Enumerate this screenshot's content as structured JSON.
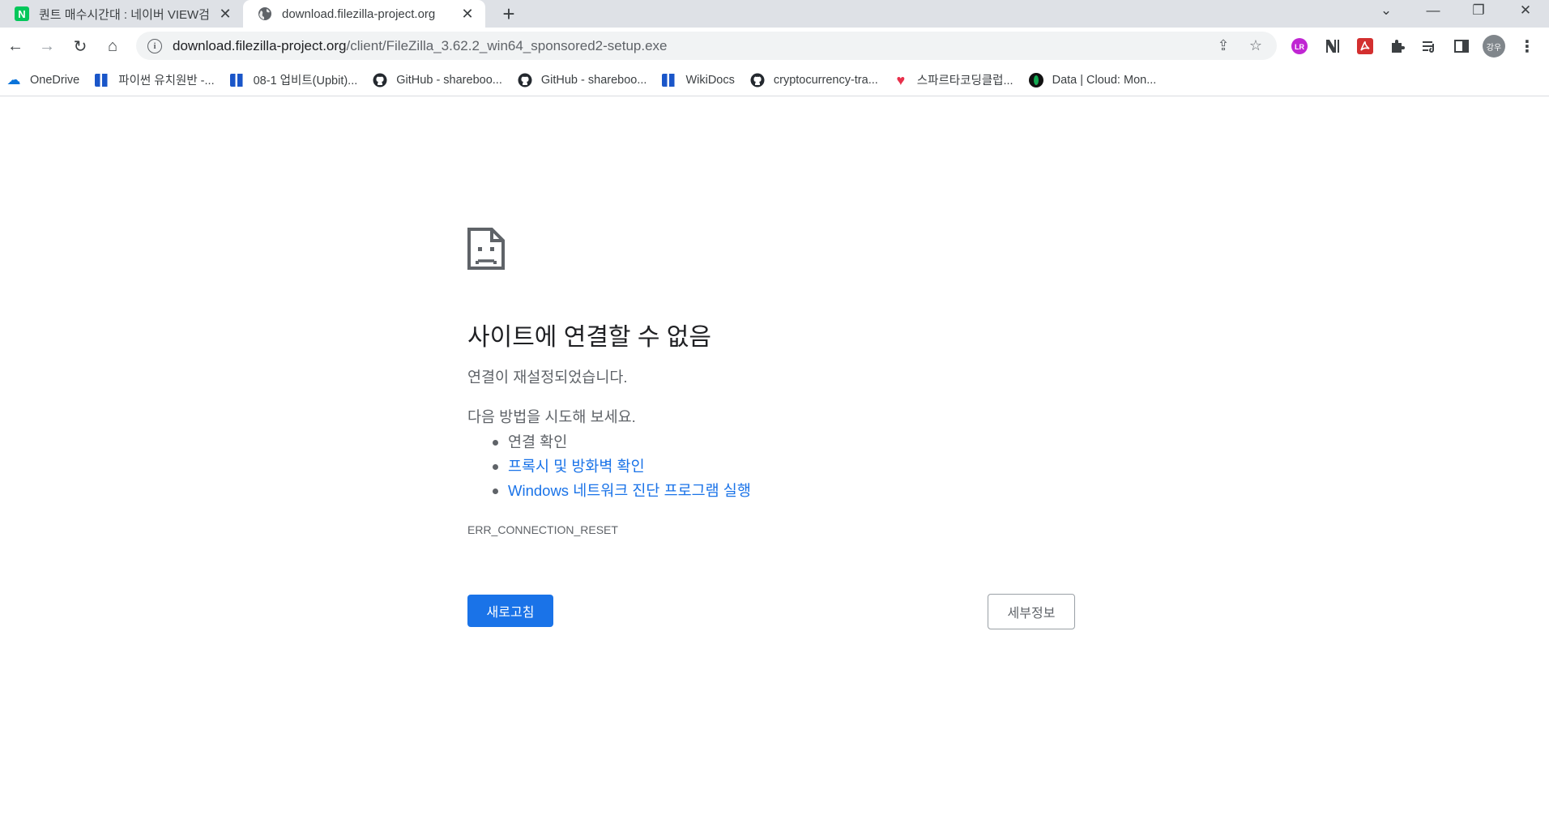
{
  "tabs": [
    {
      "title": "퀀트 매수시간대 : 네이버 VIEW검",
      "favicon": "naver-icon",
      "favicon_text": "N",
      "active": false
    },
    {
      "title": "download.filezilla-project.org",
      "favicon": "globe-icon",
      "active": true
    }
  ],
  "window_controls": {
    "tab_search": "⌄",
    "minimize": "—",
    "restore": "❐",
    "close": "✕"
  },
  "toolbar": {
    "back": "←",
    "forward": "→",
    "reload": "↻",
    "home": "⌂",
    "url_host": "download.filezilla-project.org",
    "url_path": "/client/FileZilla_3.62.2_win64_sponsored2-setup.exe",
    "share": "⇪",
    "bookmark_star": "☆",
    "avatar_text": "강우"
  },
  "bookmarks": [
    {
      "label": "OneDrive",
      "icon": "onedrive-icon"
    },
    {
      "label": "파이썬 유치원반 -...",
      "icon": "wikidocs-icon"
    },
    {
      "label": "08-1 업비트(Upbit)...",
      "icon": "wikidocs-icon"
    },
    {
      "label": "GitHub - shareboo...",
      "icon": "github-icon"
    },
    {
      "label": "GitHub - shareboo...",
      "icon": "github-icon"
    },
    {
      "label": "WikiDocs",
      "icon": "wikidocs-icon"
    },
    {
      "label": "cryptocurrency-tra...",
      "icon": "github-icon"
    },
    {
      "label": "스파르타코딩클럽...",
      "icon": "heart-icon"
    },
    {
      "label": "Data | Cloud: Mon...",
      "icon": "mongodb-leaf-icon"
    }
  ],
  "error_page": {
    "headline": "사이트에 연결할 수 없음",
    "description": "연결이 재설정되었습니다.",
    "suggest_heading": "다음 방법을 시도해 보세요.",
    "suggestions": [
      {
        "text": "연결 확인",
        "link": false
      },
      {
        "text": "프록시 및 방화벽 확인",
        "link": true
      },
      {
        "text": "Windows 네트워크 진단 프로그램 실행",
        "link": true
      }
    ],
    "error_code": "ERR_CONNECTION_RESET",
    "reload_button": "새로고침",
    "details_button": "세부정보"
  },
  "colors": {
    "accent": "#1a73e8",
    "tabstrip_bg": "#dee1e6",
    "omnibox_bg": "#f1f3f4",
    "secondary_text": "#5f6368"
  }
}
